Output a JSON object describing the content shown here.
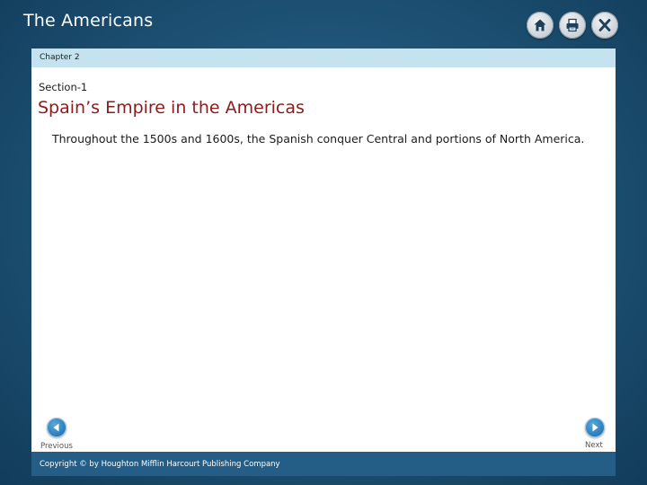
{
  "header": {
    "app_title": "The Americans",
    "icons": [
      {
        "name": "home-icon"
      },
      {
        "name": "print-icon"
      },
      {
        "name": "close-icon",
        "label": "X"
      }
    ]
  },
  "panel": {
    "chapter": "Chapter 2",
    "section": "Section-1",
    "heading": "Spain’s Empire in the Americas",
    "body": "Throughout the 1500s and 1600s, the Spanish conquer Central and portions of North America."
  },
  "nav": {
    "previous_label": "Previous",
    "next_label": "Next"
  },
  "footer": {
    "copyright": "Copyright © by Houghton Mifflin Harcourt Publishing Company"
  },
  "colors": {
    "background": "#1f5579",
    "heading": "#8c1b1b",
    "chapter_bar": "#c5e3ef",
    "footer_bar": "#245d85",
    "nav_button": "#2a7bb8"
  }
}
